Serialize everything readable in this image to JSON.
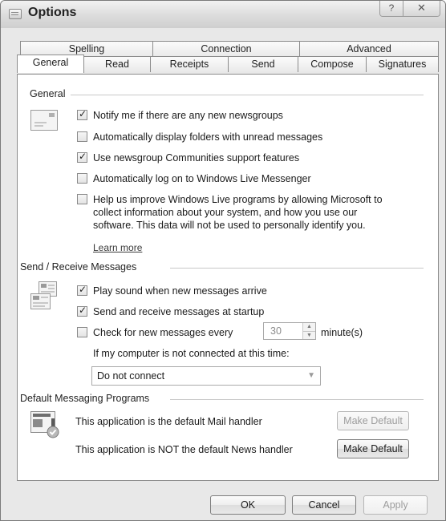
{
  "window": {
    "title": "Options",
    "help_glyph": "?",
    "close_glyph": "✕"
  },
  "tabs": {
    "row1": [
      "Spelling",
      "Connection",
      "Advanced"
    ],
    "row2": [
      "General",
      "Read",
      "Receipts",
      "Send",
      "Compose",
      "Signatures"
    ],
    "active": "General"
  },
  "general": {
    "title": "General",
    "options": [
      {
        "label": "Notify me if there are any new newsgroups",
        "checked": true
      },
      {
        "label": "Automatically display folders with unread messages",
        "checked": false
      },
      {
        "label": "Use newsgroup Communities support features",
        "checked": true
      },
      {
        "label": "Automatically log on to Windows Live Messenger",
        "checked": false
      },
      {
        "label": "Help us improve Windows Live programs by allowing Microsoft to collect information about your system, and how you use our software. This data will not be used to personally identify you.",
        "checked": false
      }
    ],
    "learn_more": "Learn more"
  },
  "send_receive": {
    "title": "Send / Receive Messages",
    "play_sound": {
      "label": "Play sound when new messages arrive",
      "checked": true
    },
    "startup": {
      "label": "Send and receive messages at startup",
      "checked": true
    },
    "check_every": {
      "label": "Check for new messages every",
      "checked": false,
      "value": "30",
      "unit": "minute(s)"
    },
    "not_connected_label": "If my computer is not connected at this time:",
    "not_connected_value": "Do not connect"
  },
  "default_programs": {
    "title": "Default Messaging Programs",
    "mail_text": "This application is the default Mail handler",
    "mail_button": "Make Default",
    "news_text": "This application is NOT the default News handler",
    "news_button": "Make Default"
  },
  "footer": {
    "ok": "OK",
    "cancel": "Cancel",
    "apply": "Apply"
  }
}
